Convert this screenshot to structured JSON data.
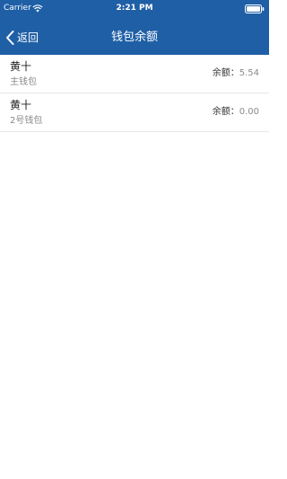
{
  "status_bar": {
    "carrier": "Carrier",
    "time": "2:21 PM",
    "wifi_icon": "wifi-icon",
    "battery_icon": "battery-icon"
  },
  "nav": {
    "back_label": "返回",
    "back_icon": "chevron-left-icon",
    "title": "钱包余额"
  },
  "colors": {
    "nav_background": "#1f5fa6",
    "nav_text": "#ffffff",
    "secondary_text": "#8a8a8a"
  },
  "wallets": [
    {
      "name": "黄十",
      "wallet_type": "主钱包",
      "balance_label": "余额：",
      "balance": "5.54"
    },
    {
      "name": "黄十",
      "wallet_type": "2号钱包",
      "balance_label": "余额：",
      "balance": "0.00"
    }
  ]
}
